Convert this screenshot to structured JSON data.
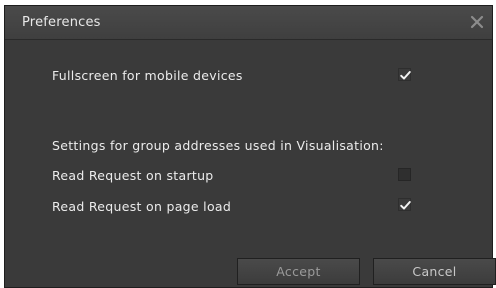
{
  "dialog": {
    "title": "Preferences",
    "close_icon": "close-icon"
  },
  "options": {
    "fullscreen_label": "Fullscreen for mobile devices",
    "fullscreen_checked": true,
    "group_heading": "Settings for group addresses used in Visualisation:",
    "read_startup_label": "Read Request on startup",
    "read_startup_checked": false,
    "read_pageload_label": "Read Request on page load",
    "read_pageload_checked": true
  },
  "buttons": {
    "accept_label": "Accept",
    "cancel_label": "Cancel"
  },
  "colors": {
    "background": "#3a3a3a",
    "titlebar": "#454545",
    "text": "#e6e6e6",
    "disabled_text": "#9a9a9a"
  }
}
